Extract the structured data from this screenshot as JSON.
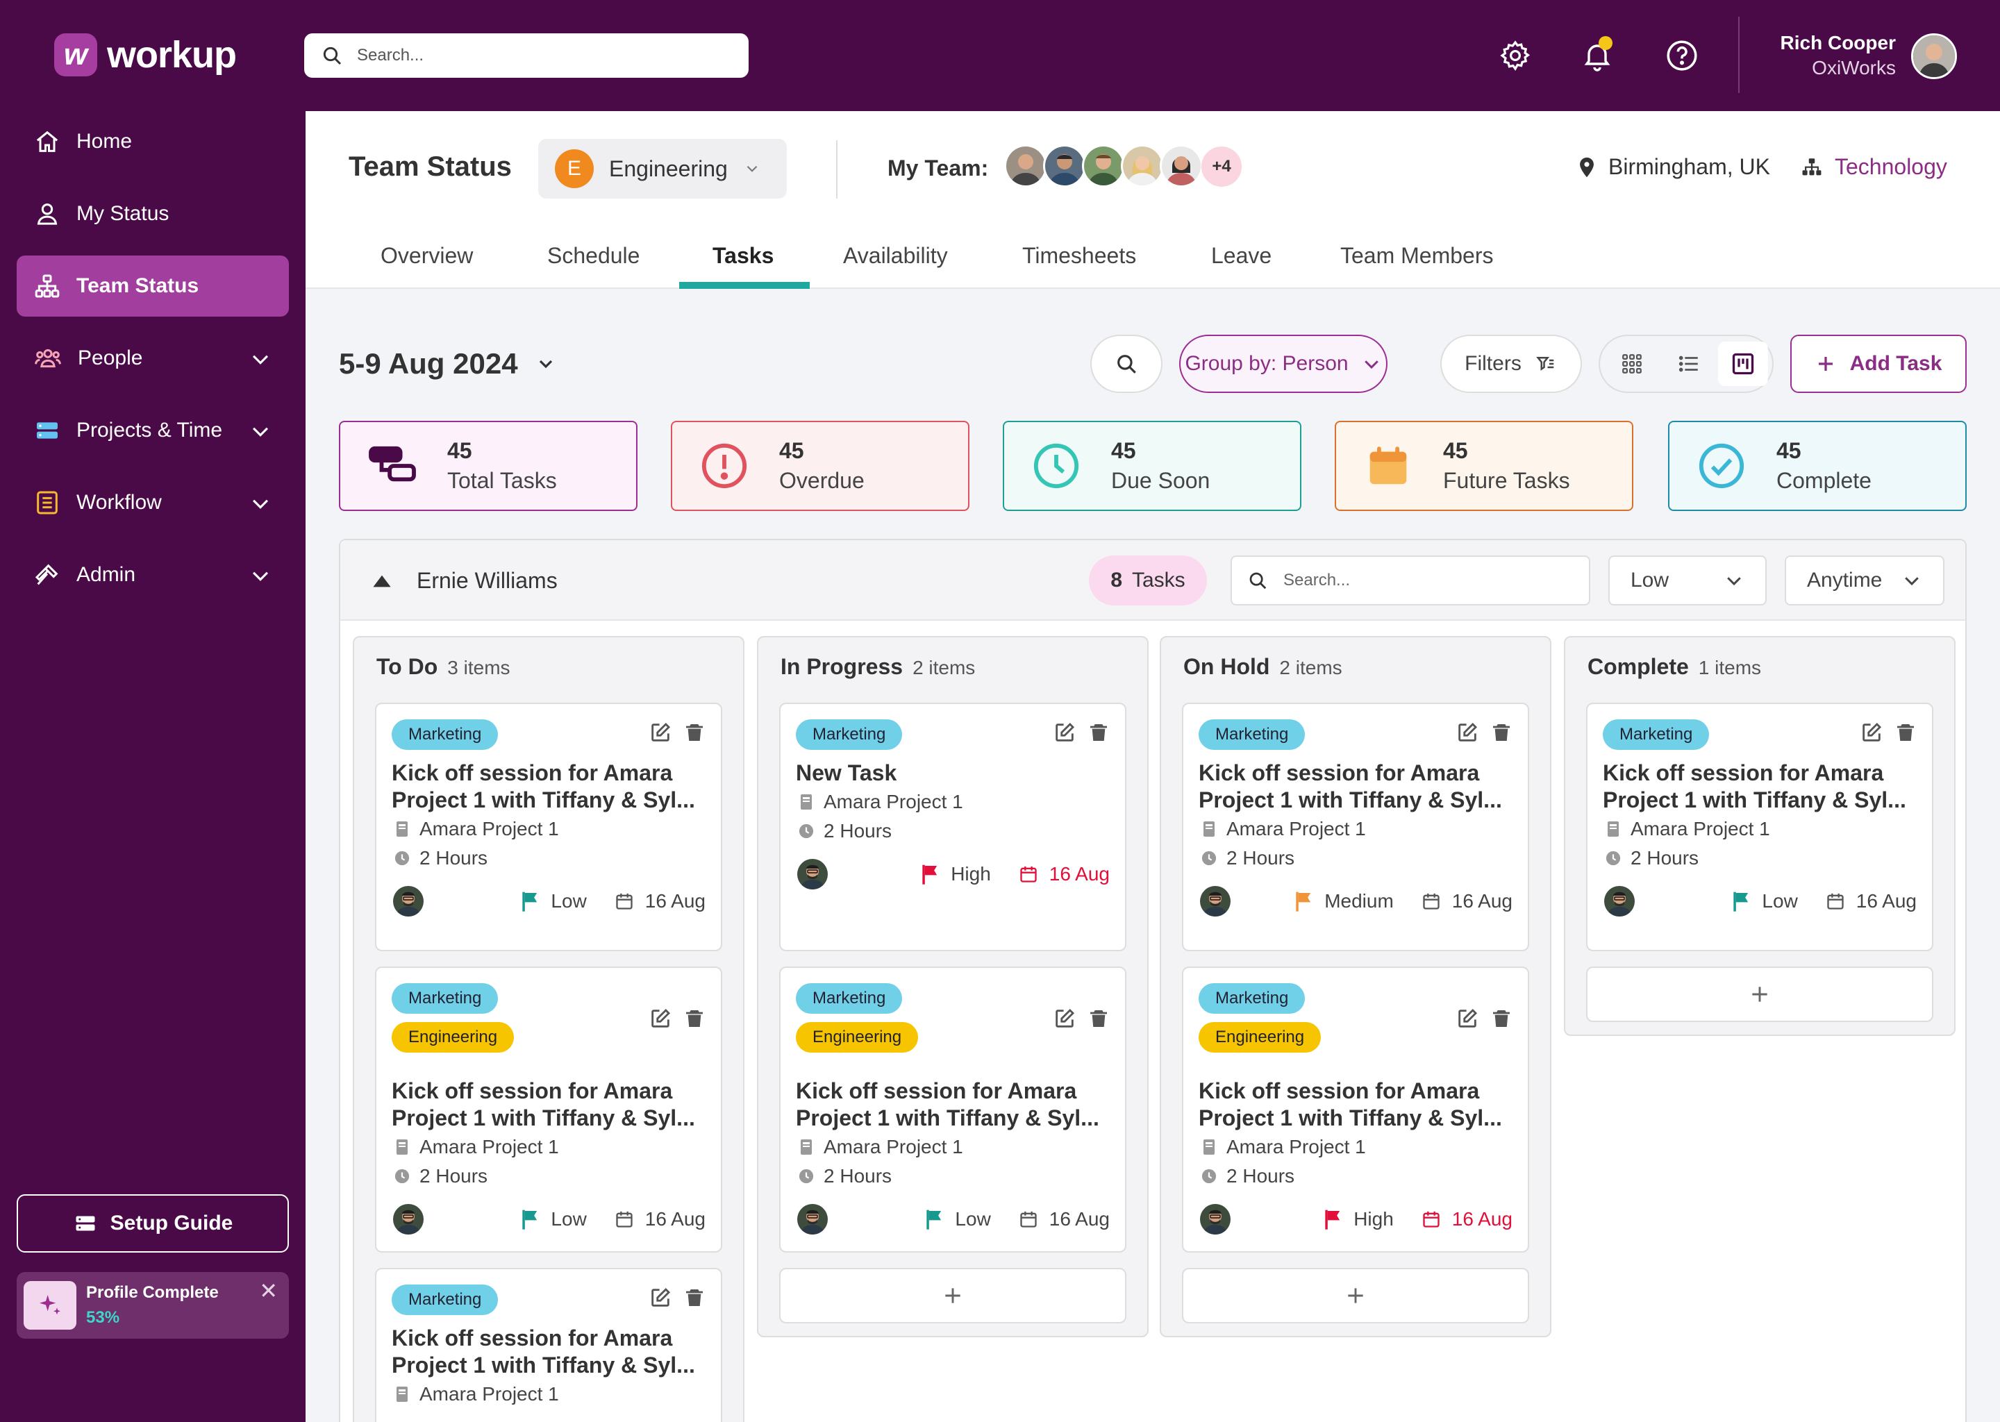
{
  "app": {
    "name": "workup"
  },
  "search": {
    "placeholder": "Search..."
  },
  "user": {
    "name": "Rich Cooper",
    "company": "OxiWorks"
  },
  "sidebar": {
    "items": [
      {
        "label": "Home",
        "icon": "home-icon"
      },
      {
        "label": "My Status",
        "icon": "user-icon"
      },
      {
        "label": "Team Status",
        "icon": "org-chart-icon",
        "active": true
      },
      {
        "label": "People",
        "icon": "people-icon"
      },
      {
        "label": "Projects & Time",
        "icon": "projects-icon"
      },
      {
        "label": "Workflow",
        "icon": "workflow-icon"
      },
      {
        "label": "Admin",
        "icon": "hammer-icon"
      }
    ],
    "setup_guide": "Setup Guide",
    "profile": {
      "title": "Profile Complete",
      "percent": "53%"
    }
  },
  "header": {
    "title": "Team Status",
    "department": {
      "initial": "E",
      "name": "Engineering"
    },
    "my_team_label": "My Team:",
    "team_extra": "+4",
    "location": "Birmingham, UK",
    "sector": "Technology",
    "tabs": [
      "Overview",
      "Schedule",
      "Tasks",
      "Availability",
      "Timesheets",
      "Leave",
      "Team Members"
    ],
    "active_tab": "Tasks"
  },
  "toolbar": {
    "date_range": "5-9 Aug 2024",
    "group_by": "Group by: Person",
    "filters": "Filters",
    "add_task": "Add Task"
  },
  "stats": [
    {
      "value": "45",
      "label": "Total Tasks",
      "color": "#9c2e93",
      "bg": "#fdf2fc"
    },
    {
      "value": "45",
      "label": "Overdue",
      "color": "#e0525d",
      "bg": "#fdf0f1"
    },
    {
      "value": "45",
      "label": "Due Soon",
      "color": "#35c5b4",
      "bg": "#effaf9"
    },
    {
      "value": "45",
      "label": "Future Tasks",
      "color": "#f0943a",
      "bg": "#fef6ec"
    },
    {
      "value": "45",
      "label": "Complete",
      "color": "#3ab7d6",
      "bg": "#eef9fc"
    }
  ],
  "board": {
    "person": "Ernie Williams",
    "task_count": "8",
    "task_word": "Tasks",
    "search_placeholder": "Search...",
    "priority_filter": "Low",
    "time_filter": "Anytime",
    "columns": [
      {
        "title": "To Do",
        "count": "3 items",
        "cards": [
          {
            "tags": [
              "Marketing"
            ],
            "title": "Kick off session for Amara Project 1 with Tiffany & Syl...",
            "project": "Amara Project 1",
            "duration": "2 Hours",
            "priority": "Low",
            "due": "16 Aug"
          },
          {
            "tags": [
              "Marketing",
              "Engineering"
            ],
            "title": "Kick off session for Amara Project 1 with Tiffany & Syl...",
            "project": "Amara Project 1",
            "duration": "2 Hours",
            "priority": "Low",
            "due": "16 Aug"
          },
          {
            "tags": [
              "Marketing"
            ],
            "title": "Kick off session for Amara Project 1 with Tiffany & Syl...",
            "project": "Amara Project 1"
          }
        ]
      },
      {
        "title": "In Progress",
        "count": "2 items",
        "cards": [
          {
            "tags": [
              "Marketing"
            ],
            "title": "New Task",
            "project": "Amara Project 1",
            "duration": "2 Hours",
            "priority": "High",
            "due": "16 Aug"
          },
          {
            "tags": [
              "Marketing",
              "Engineering"
            ],
            "title": "Kick off session for Amara Project 1 with Tiffany & Syl...",
            "project": "Amara Project 1",
            "duration": "2 Hours",
            "priority": "Low",
            "due": "16 Aug"
          }
        ]
      },
      {
        "title": "On Hold",
        "count": "2 items",
        "cards": [
          {
            "tags": [
              "Marketing"
            ],
            "title": "Kick off session for Amara Project 1 with Tiffany & Syl...",
            "project": "Amara Project 1",
            "duration": "2 Hours",
            "priority": "Medium",
            "due": "16 Aug"
          },
          {
            "tags": [
              "Marketing",
              "Engineering"
            ],
            "title": "Kick off session for Amara Project 1 with Tiffany & Syl...",
            "project": "Amara Project 1",
            "duration": "2 Hours",
            "priority": "High",
            "due": "16 Aug"
          }
        ]
      },
      {
        "title": "Complete",
        "count": "1 items",
        "cards": [
          {
            "tags": [
              "Marketing"
            ],
            "title": "Kick off session for Amara Project 1 with Tiffany & Syl...",
            "project": "Amara Project 1",
            "duration": "2 Hours",
            "priority": "Low",
            "due": "16 Aug"
          }
        ]
      }
    ]
  },
  "colors": {
    "brand": "#4a0a48",
    "accent": "#9c2e93",
    "tab_underline": "#1fa7a0",
    "flag_low": "#17998f",
    "flag_medium": "#f0943a",
    "flag_high": "#e0103a"
  }
}
